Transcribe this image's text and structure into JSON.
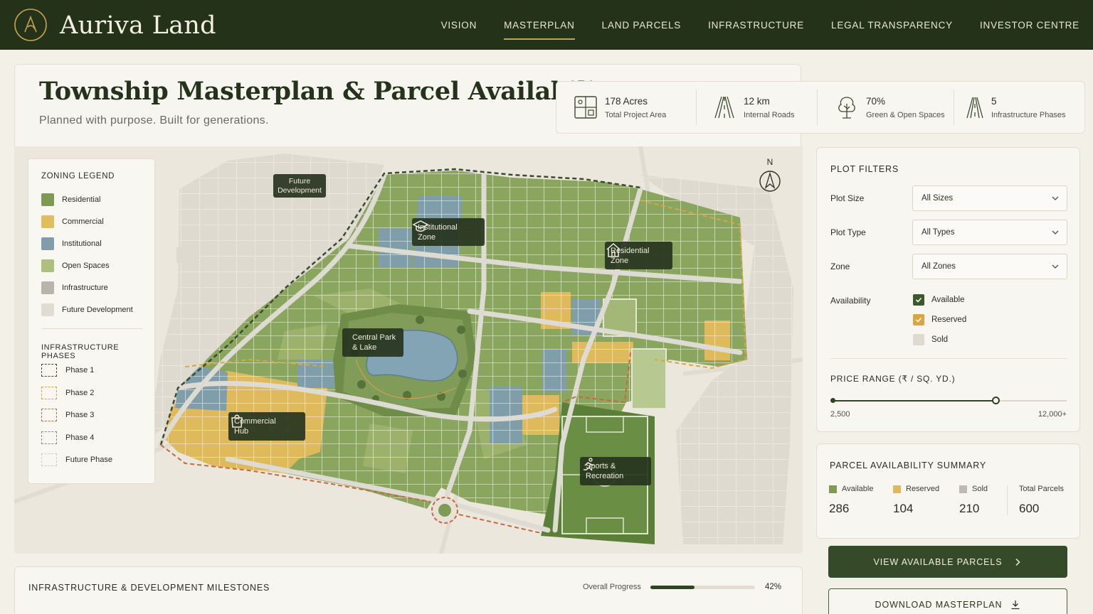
{
  "brand": {
    "name": "Auriva Land"
  },
  "nav": [
    {
      "label": "VISION",
      "active": false
    },
    {
      "label": "MASTERPLAN",
      "active": true
    },
    {
      "label": "LAND PARCELS",
      "active": false
    },
    {
      "label": "INFRASTRUCTURE",
      "active": false
    },
    {
      "label": "LEGAL TRANSPARENCY",
      "active": false
    },
    {
      "label": "INVESTOR CENTRE",
      "active": false
    }
  ],
  "page": {
    "title": "Township Masterplan & Parcel Availability",
    "subtitle": "Planned with purpose. Built for generations."
  },
  "stats": [
    {
      "value": "178 Acres",
      "label": "Total Project Area",
      "icon": "grid-plan-icon"
    },
    {
      "value": "12 km",
      "label": "Internal Roads",
      "icon": "road-icon"
    },
    {
      "value": "70%",
      "label": "Green & Open Spaces",
      "icon": "tree-icon"
    },
    {
      "value": "5",
      "label": "Infrastructure Phases",
      "icon": "phases-road-icon"
    }
  ],
  "legend": {
    "zoning_title": "ZONING LEGEND",
    "zones": [
      {
        "label": "Residential",
        "color": "#7f9a55"
      },
      {
        "label": "Commercial",
        "color": "#e0bd5e"
      },
      {
        "label": "Institutional",
        "color": "#7f9eaa"
      },
      {
        "label": "Open Spaces",
        "color": "#aebf7e"
      },
      {
        "label": "Infrastructure",
        "color": "#b8b5ad"
      },
      {
        "label": "Future Development",
        "color": "#e0dcd1"
      }
    ],
    "phases_title": "INFRASTRUCTURE PHASES",
    "phases": [
      {
        "label": "Phase 1",
        "color": "#3b4a30"
      },
      {
        "label": "Phase 2",
        "color": "#d9a642"
      },
      {
        "label": "Phase 3",
        "color": "#c7683e"
      },
      {
        "label": "Phase 4",
        "color": "#8a8a82"
      },
      {
        "label": "Future Phase",
        "color": "#cfcbc0"
      }
    ]
  },
  "map": {
    "compass": "N",
    "labels": {
      "future": "Future Development",
      "institutional": "Institutional Zone",
      "residential": "Residential Zone",
      "park": "Central Park & Lake",
      "commercial": "Commercial Hub",
      "sports": "Sports & Recreation"
    }
  },
  "filters": {
    "title": "PLOT FILTERS",
    "plot_size_label": "Plot Size",
    "plot_size_value": "All Sizes",
    "plot_type_label": "Plot Type",
    "plot_type_value": "All Types",
    "zone_label": "Zone",
    "zone_value": "All Zones",
    "availability_label": "Availability",
    "availability": [
      {
        "label": "Available",
        "checked": true,
        "color": "#3b5a2b"
      },
      {
        "label": "Reserved",
        "checked": true,
        "color": "#d9a642"
      },
      {
        "label": "Sold",
        "checked": false,
        "color": "#dedad0"
      }
    ],
    "price_title": "PRICE RANGE (₹ / SQ. YD.)",
    "price_min": "2,500",
    "price_max": "12,000+",
    "price_selected_fraction": 0.7
  },
  "summary": {
    "title": "PARCEL AVAILABILITY SUMMARY",
    "available_label": "Available",
    "available_value": "286",
    "reserved_label": "Reserved",
    "reserved_value": "104",
    "sold_label": "Sold",
    "sold_value": "210",
    "total_label": "Total Parcels",
    "total_value": "600"
  },
  "actions": {
    "view": "VIEW AVAILABLE PARCELS",
    "download": "DOWNLOAD MASTERPLAN"
  },
  "milestones": {
    "title": "INFRASTRUCTURE & DEVELOPMENT MILESTONES",
    "progress_label": "Overall Progress",
    "progress_value": "42%",
    "progress_fraction": 0.42
  }
}
